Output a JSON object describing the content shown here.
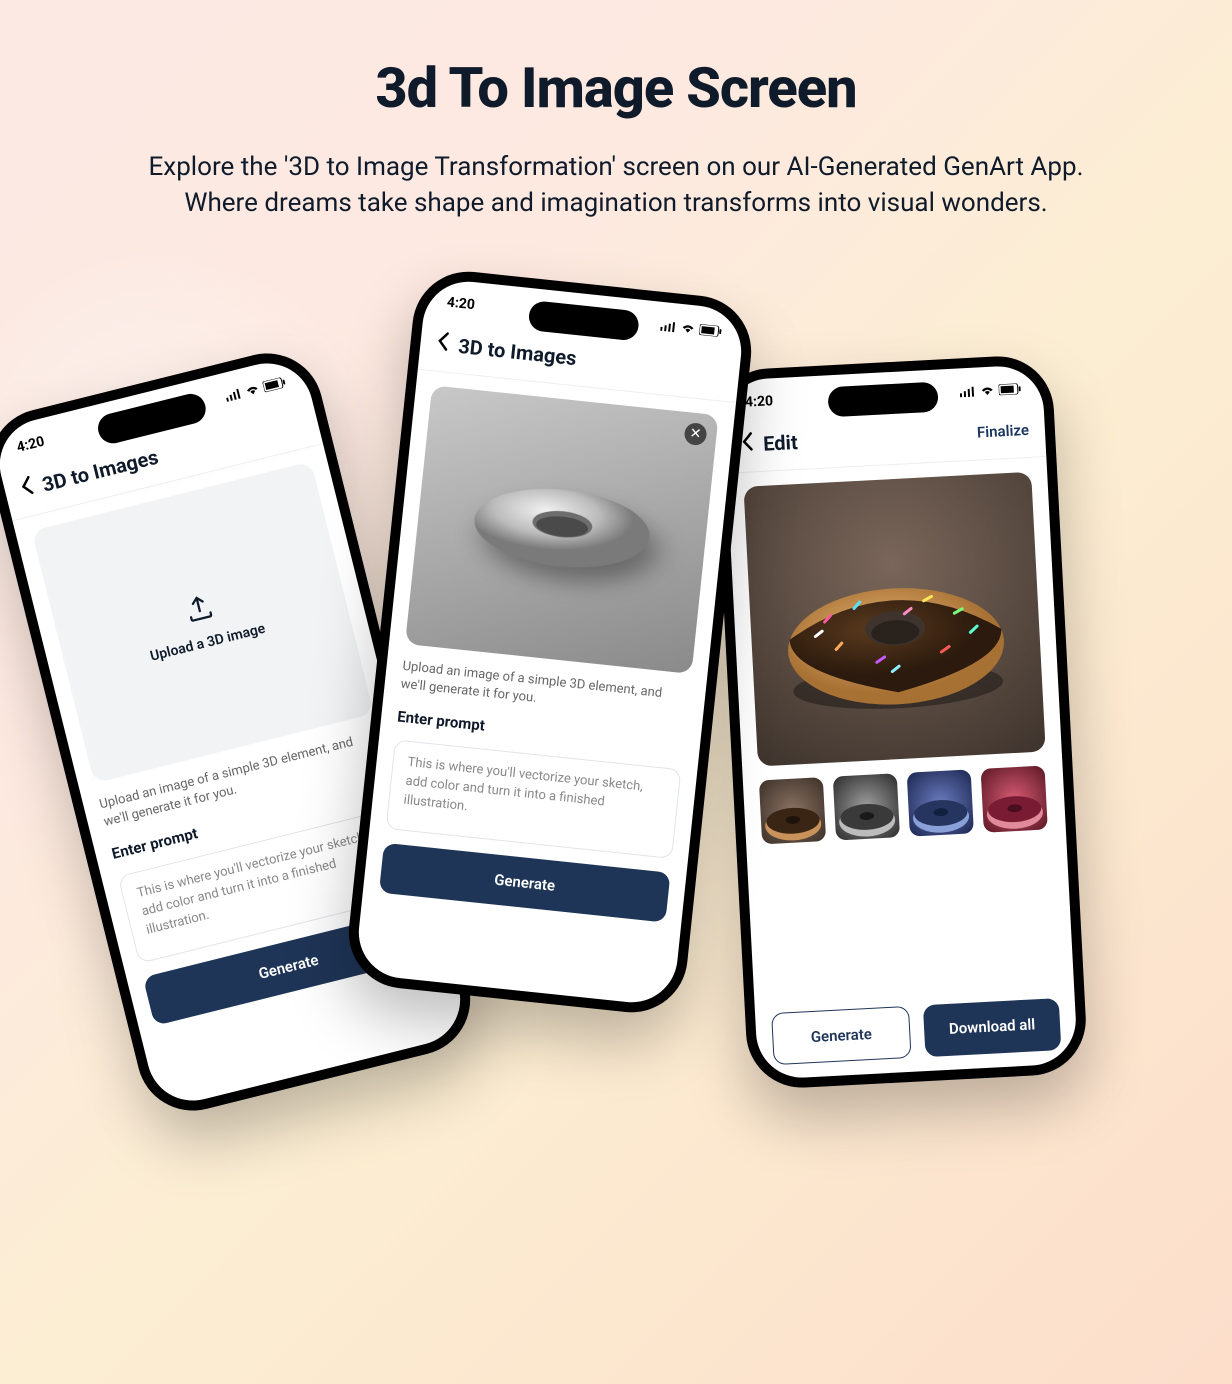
{
  "hero": {
    "title": "3d To Image Screen",
    "subtitle": "Explore the '3D to Image Transformation' screen on our AI-Generated GenArt App. Where dreams take shape and imagination transforms into visual wonders."
  },
  "status": {
    "time": "4:20"
  },
  "phones": {
    "upload": {
      "title": "3D to Images",
      "upload_label": "Upload a 3D image",
      "helper": "Upload an image of a simple 3D element, and we'll generate it for you.",
      "prompt_label": "Enter prompt",
      "prompt_placeholder": "This is where you'll vectorize your sketch, add color and turn it into a finished illustration.",
      "cta": "Generate"
    },
    "preview": {
      "title": "3D to Images",
      "helper": "Upload an image of a simple 3D element, and we'll generate it for you.",
      "prompt_label": "Enter prompt",
      "prompt_placeholder": "This is where you'll vectorize your sketch, add color and turn it into a finished illustration.",
      "cta": "Generate"
    },
    "edit": {
      "title": "Edit",
      "finalize": "Finalize",
      "generate": "Generate",
      "download": "Download all"
    }
  }
}
